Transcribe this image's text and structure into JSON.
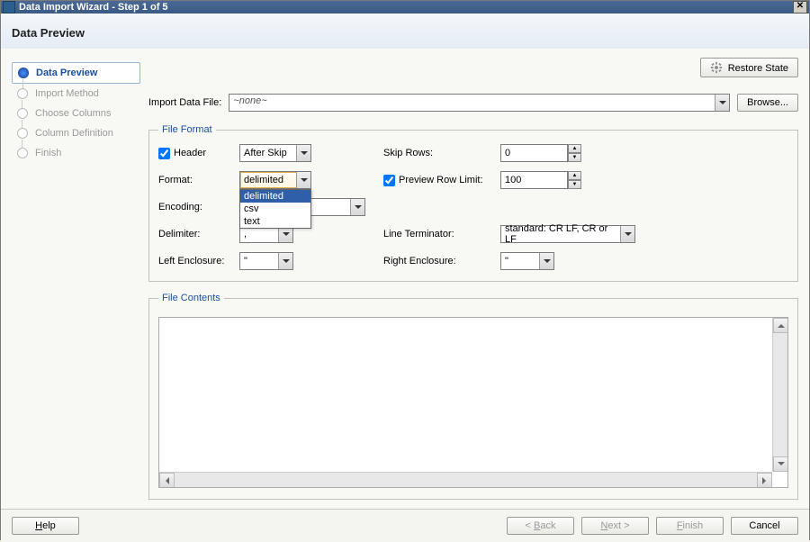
{
  "titlebar": {
    "title": "Data Import Wizard - Step 1 of 5"
  },
  "header": {
    "page_title": "Data Preview"
  },
  "sidebar": {
    "steps": [
      {
        "label": "Data Preview",
        "active": true
      },
      {
        "label": "Import Method",
        "active": false
      },
      {
        "label": "Choose Columns",
        "active": false
      },
      {
        "label": "Column Definition",
        "active": false
      },
      {
        "label": "Finish",
        "active": false
      }
    ]
  },
  "restore_btn": "Restore State",
  "file_row": {
    "label": "Import Data File:",
    "value": "~none~",
    "browse": "Browse..."
  },
  "file_format": {
    "legend": "File Format",
    "header_label": "Header",
    "header_checked": true,
    "header_mode": "After Skip",
    "skip_rows_label": "Skip Rows:",
    "skip_rows": 0,
    "format_label": "Format:",
    "format_value": "delimited",
    "format_options": [
      "delimited",
      "csv",
      "text"
    ],
    "preview_limit_label": "Preview Row Limit:",
    "preview_limit_checked": true,
    "preview_limit": 100,
    "encoding_label": "Encoding:",
    "encoding_value": "",
    "delimiter_label": "Delimiter:",
    "delimiter_value": ",",
    "line_term_label": "Line Terminator:",
    "line_term_value": "standard: CR LF, CR or LF",
    "left_enc_label": "Left Enclosure:",
    "left_enc_value": "\"",
    "right_enc_label": "Right Enclosure:",
    "right_enc_value": "\""
  },
  "file_contents_legend": "File Contents",
  "footer": {
    "help": "Help",
    "back": "< Back",
    "next": "Next >",
    "finish": "Finish",
    "cancel": "Cancel"
  }
}
